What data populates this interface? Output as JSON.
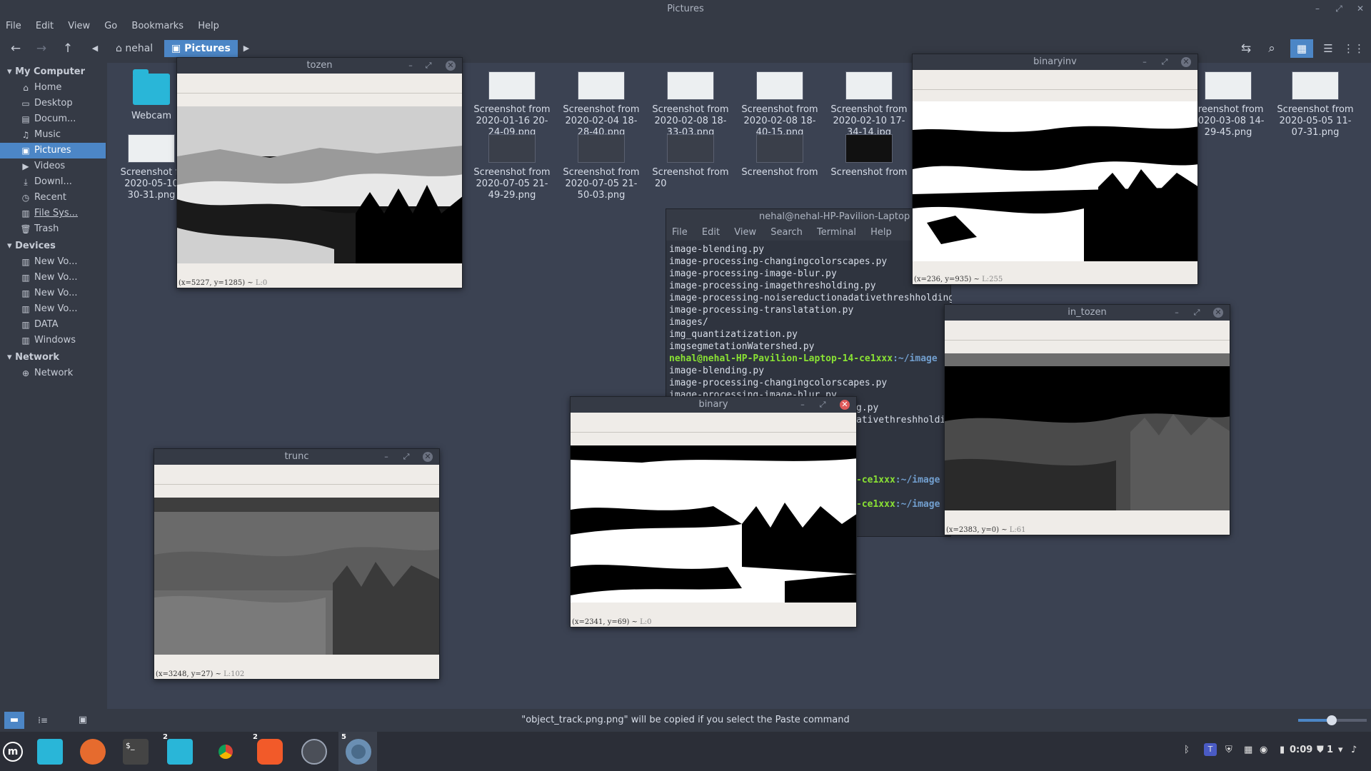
{
  "window": {
    "title": "Pictures"
  },
  "menubar": [
    "File",
    "Edit",
    "View",
    "Go",
    "Bookmarks",
    "Help"
  ],
  "breadcrumb": {
    "home": "nehal",
    "current": "Pictures"
  },
  "sidebar": {
    "my_computer": {
      "heading": "My Computer",
      "items": [
        "Home",
        "Desktop",
        "Docum...",
        "Music",
        "Pictures",
        "Videos",
        "Downl...",
        "Recent",
        "File Sys...",
        "Trash"
      ]
    },
    "devices": {
      "heading": "Devices",
      "items": [
        "New Vo...",
        "New Vo...",
        "New Vo...",
        "New Vo...",
        "DATA",
        "Windows"
      ]
    },
    "network": {
      "heading": "Network",
      "items": [
        "Network"
      ]
    }
  },
  "files": {
    "webcam": "Webcam",
    "row1": [
      [
        "Screenshot from",
        "2020-01-16 20-",
        "24-09.png"
      ],
      [
        "Screenshot from",
        "2020-02-04 18-",
        "28-40.png"
      ],
      [
        "Screenshot from",
        "2020-02-08 18-",
        "33-03.png"
      ],
      [
        "Screenshot from",
        "2020-02-08 18-",
        "40-15.png"
      ],
      [
        "Screenshot from",
        "2020-02-10 17-",
        "34-14.jpg"
      ],
      [
        "creenshot from",
        "2020-03-08 14-",
        "29-45.png"
      ],
      [
        "Screenshot from",
        "2020-05-05 11-",
        "07-31.png"
      ]
    ],
    "row2": [
      [
        "Screenshot fr",
        "2020-05-10",
        "30-31.png"
      ],
      [
        "Screenshot from",
        "2020-07-05 21-",
        "49-29.png"
      ],
      [
        "Screenshot from",
        "2020-07-05 21-",
        "50-03.png"
      ],
      [
        "Screenshot from",
        "20",
        ""
      ],
      [
        "Screenshot from",
        "",
        ""
      ],
      [
        "Screenshot from",
        "",
        ""
      ]
    ]
  },
  "status": "\"object_track.png.png\" will be copied if you select the Paste command",
  "terminal": {
    "title": "nehal@nehal-HP-Pavilion-Laptop",
    "menu": [
      "File",
      "Edit",
      "View",
      "Search",
      "Terminal",
      "Help"
    ],
    "lines": [
      "image-blending.py",
      "image-processing-changingcolorscapes.py",
      "image-processing-image-blur.py",
      "image-processing-imagethresholding.py",
      "image-processing-noisereductionadativethreshholding.py",
      "image-processing-translatation.py",
      "images/",
      "img_quantizatization.py",
      "imgsegmetationWatershed.py"
    ],
    "prompt_user": "nehal@nehal-HP-Pavilion-Laptop-14-ce1xxx",
    "prompt_path": ":~/image",
    "lines2": [
      "image-blending.py",
      "image-processing-changingcolorscapes.py",
      "image-processing-image-blur.py"
    ],
    "fragments": [
      "g.py",
      "ativethreshholdi"
    ],
    "prompt_tail": "-ce1xxx",
    "prompt_tail_path": ":~/image"
  },
  "image_windows": {
    "tozen": {
      "title": "tozen",
      "coord": "(x=5227, y=1285) ~ ",
      "level": "L:0"
    },
    "binaryinv": {
      "title": "binaryinv",
      "coord": "(x=236, y=935) ~ ",
      "level": "L:255"
    },
    "in_tozen": {
      "title": "in_tozen",
      "coord": "(x=2383, y=0) ~ ",
      "level": "L:61"
    },
    "binary": {
      "title": "binary",
      "coord": "(x=2341, y=69) ~ ",
      "level": "L:0"
    },
    "trunc": {
      "title": "trunc",
      "coord": "(x=3248, y=27) ~ ",
      "level": "L:102"
    }
  },
  "taskbar": {
    "badges": [
      "2",
      "2",
      "5"
    ],
    "clock": "0:09",
    "battery": "1"
  },
  "colors": {
    "accent": "#4c86c6",
    "panel": "#353a45",
    "background": "#3b4252"
  }
}
